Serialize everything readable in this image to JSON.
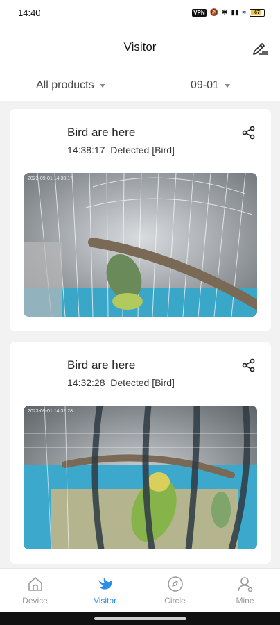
{
  "status_bar": {
    "time": "14:40",
    "vpn": "VPN",
    "battery": "67"
  },
  "header": {
    "title": "Visitor",
    "edit_icon": "edit-icon"
  },
  "filters": {
    "product": "All products",
    "date": "09-01"
  },
  "events": [
    {
      "title": "Bird are here",
      "time": "14:38:17",
      "detected": "Detected [Bird]",
      "overlay_timestamp": "2023-09-01 14:38:17"
    },
    {
      "title": "Bird are here",
      "time": "14:32:28",
      "detected": "Detected [Bird]",
      "overlay_timestamp": "2023-09-01 14:32:28"
    }
  ],
  "tabs": [
    {
      "label": "Device",
      "icon": "home-icon",
      "active": false
    },
    {
      "label": "Visitor",
      "icon": "bird-icon",
      "active": true
    },
    {
      "label": "Circle",
      "icon": "compass-icon",
      "active": false
    },
    {
      "label": "Mine",
      "icon": "person-icon",
      "active": false
    }
  ],
  "colors": {
    "accent": "#2b8ee8",
    "inactive": "#9a9a9a",
    "background": "#f2f2f2"
  }
}
